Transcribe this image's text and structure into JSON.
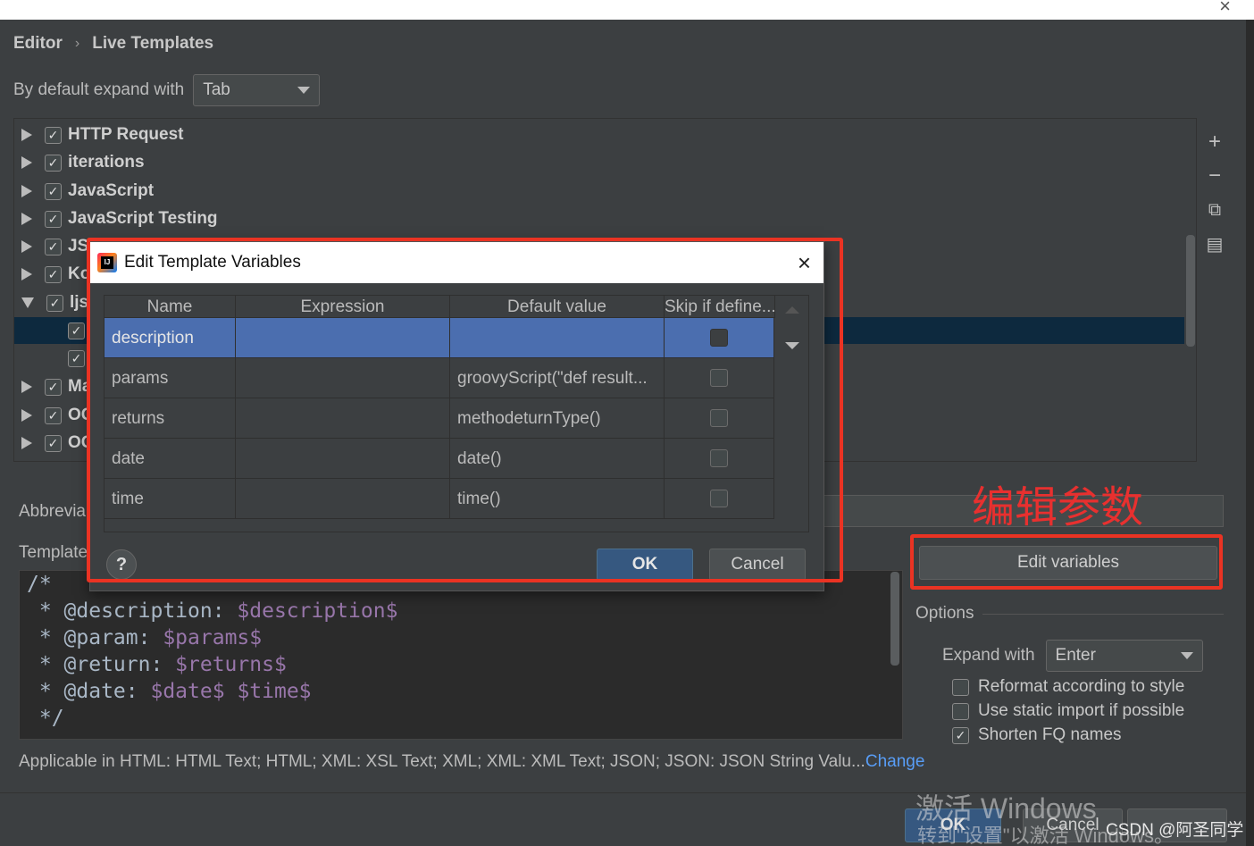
{
  "breadcrumb": {
    "parent": "Editor",
    "separator": "›",
    "current": "Live Templates"
  },
  "default_expand": {
    "label": "By default expand with",
    "value": "Tab"
  },
  "tree": {
    "groups": [
      {
        "label": "HTTP Request",
        "checked": "✓"
      },
      {
        "label": "iterations",
        "checked": "✓"
      },
      {
        "label": "JavaScript",
        "checked": "✓"
      },
      {
        "label": "JavaScript Testing",
        "checked": "✓"
      },
      {
        "label": "JSF",
        "checked": "✓"
      },
      {
        "label": "Ko",
        "checked": "✓"
      },
      {
        "label": "ljs",
        "checked": "✓"
      },
      {
        "label": "",
        "checked": "✓"
      },
      {
        "label": "",
        "checked": "✓"
      },
      {
        "label": "Ma",
        "checked": "✓"
      },
      {
        "label": "OC",
        "checked": "✓"
      },
      {
        "label": "OC",
        "checked": "✓"
      }
    ]
  },
  "toolbar": {
    "add": "+",
    "remove": "−",
    "copy": "⧉",
    "restore": "▤"
  },
  "abbreviation_label": "Abbrevia",
  "template_label": "Template",
  "template_text": {
    "l1": "/*",
    "l2_prefix": " * @description: ",
    "l2_var": "$description$",
    "l3_prefix": " * @param: ",
    "l3_var": "$params$",
    "l4_prefix": " * @return: ",
    "l4_var": "$returns$",
    "l5_prefix": " * @date: ",
    "l5_var1": "$date$",
    "l5_var2": "$time$",
    "l6": " */"
  },
  "applicable": {
    "text": "Applicable in HTML: HTML Text; HTML; XML: XSL Text; XML; XML: XML Text; JSON; JSON: JSON String Valu...",
    "link": "Change"
  },
  "edit_variables_button": "Edit variables",
  "options": {
    "label": "Options",
    "expand_with_label": "Expand with",
    "expand_with_value": "Enter",
    "reformat": {
      "label": "Reformat according to style",
      "checked": ""
    },
    "static_import": {
      "label": "Use static import if possible",
      "checked": ""
    },
    "shorten_fq": {
      "label": "Shorten FQ names",
      "checked": "✓"
    }
  },
  "footer": {
    "ok": "OK",
    "cancel": "Cancel"
  },
  "watermark": {
    "line1": "激活 Windows",
    "line2": "转到\"设置\"以激活 Windows。"
  },
  "csdn": "CSDN @阿圣同学",
  "annotation": "编辑参数",
  "dialog": {
    "title": "Edit Template Variables",
    "icon_text": "IJ",
    "columns": [
      "Name",
      "Expression",
      "Default value",
      "Skip if define..."
    ],
    "rows": [
      {
        "name": "description",
        "expression": "",
        "default": ""
      },
      {
        "name": "params",
        "expression": "",
        "default": "groovyScript(\"def result..."
      },
      {
        "name": "returns",
        "expression": "",
        "default": "methodeturnType()"
      },
      {
        "name": "date",
        "expression": "",
        "default": "date()"
      },
      {
        "name": "time",
        "expression": "",
        "default": "time()"
      }
    ],
    "help": "?",
    "ok": "OK",
    "cancel": "Cancel"
  },
  "colors": {
    "accent": "#365880",
    "selection": "#4b6eaf",
    "annotation_red": "#ea3323",
    "template_var": "#9876aa"
  }
}
